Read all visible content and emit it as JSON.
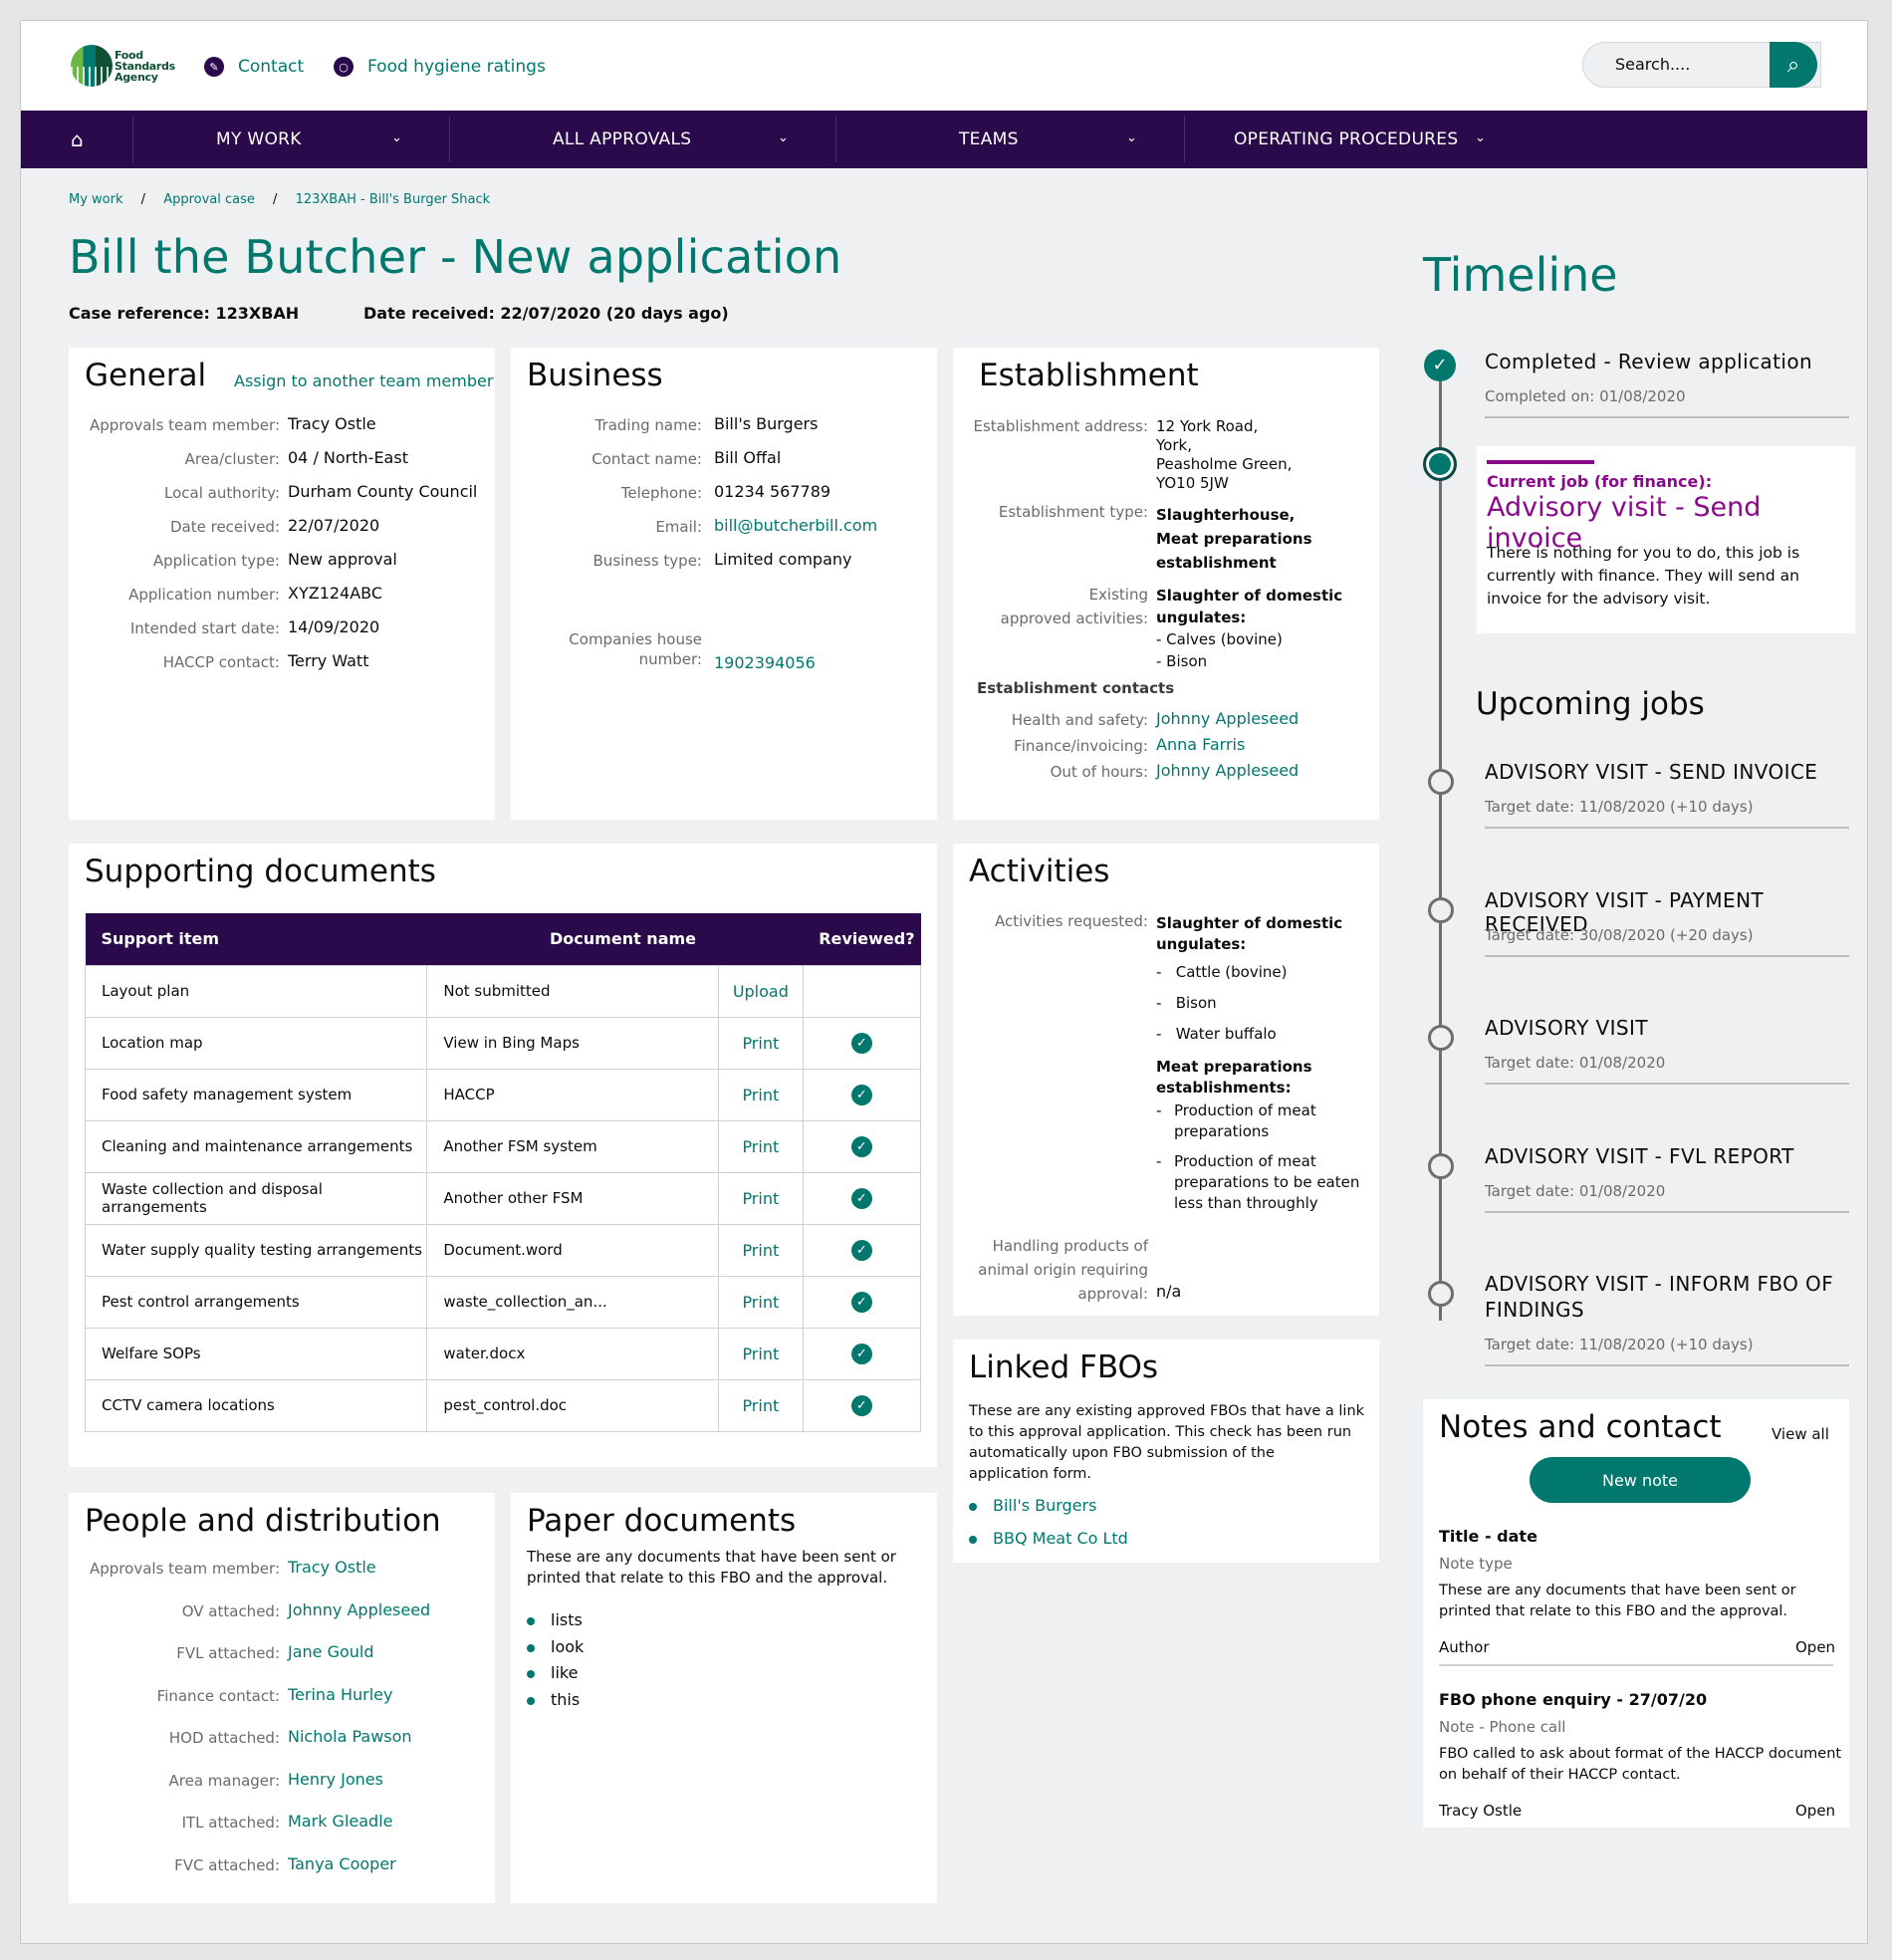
{
  "header": {
    "logo_text": "Food Standards Agency",
    "contact": "Contact",
    "ratings": "Food hygiene ratings",
    "search_placeholder": "Search...."
  },
  "nav": {
    "items": [
      "MY WORK",
      "ALL APPROVALS",
      "TEAMS",
      "OPERATING PROCEDURES"
    ]
  },
  "breadcrumbs": [
    "My work",
    "Approval case",
    "123XBAH - Bill's Burger Shack"
  ],
  "page": {
    "title": "Bill the Butcher - New application",
    "case_ref": "Case reference: 123XBAH",
    "date_received": "Date received: 22/07/2020 (20 days ago)"
  },
  "general": {
    "title": "General",
    "assign_link": "Assign to another team member",
    "rows": [
      [
        "Approvals team member:",
        "Tracy Ostle"
      ],
      [
        "Area/cluster:",
        "04 / North-East"
      ],
      [
        "Local authority:",
        "Durham County Council"
      ],
      [
        "Date received:",
        "22/07/2020"
      ],
      [
        "Application type:",
        "New approval"
      ],
      [
        "Application number:",
        "XYZ124ABC"
      ],
      [
        "Intended start date:",
        "14/09/2020"
      ],
      [
        "HACCP contact:",
        "Terry Watt"
      ]
    ]
  },
  "business": {
    "title": "Business",
    "rows": [
      [
        "Trading name:",
        "Bill's Burgers"
      ],
      [
        "Contact name:",
        "Bill Offal"
      ],
      [
        "Telephone:",
        "01234 567789"
      ],
      [
        "Email:",
        "bill@butcherbill.com"
      ],
      [
        "Business type:",
        "Limited company"
      ]
    ],
    "ch_label_1": "Companies house",
    "ch_label_2": "number:",
    "ch_value": "1902394056"
  },
  "establishment": {
    "title": "Establishment",
    "address_label": "Establishment address:",
    "address": [
      "12 York Road,",
      "York,",
      "Peasholme Green,",
      "YO10 5JW"
    ],
    "type_label": "Establishment type:",
    "type": [
      "Slaughterhouse,",
      "Meat preparations",
      "establishment"
    ],
    "existing_label_1": "Existing",
    "existing_label_2": "approved activities:",
    "existing": [
      "Slaughter of domestic",
      "ungulates:"
    ],
    "existing_items": [
      "- Calves (bovine)",
      "- Bison"
    ],
    "contacts_heading": "Establishment contacts",
    "contacts": [
      [
        "Health and safety:",
        "Johnny Appleseed"
      ],
      [
        "Finance/invoicing:",
        "Anna Farris"
      ],
      [
        "Out of hours:",
        "Johnny Appleseed"
      ]
    ]
  },
  "supporting": {
    "title": "Supporting documents",
    "headers": [
      "Support item",
      "Document name",
      "Reviewed?"
    ],
    "rows": [
      [
        "Layout plan",
        "Not submitted",
        "Upload",
        false
      ],
      [
        "Location map",
        "View in Bing Maps",
        "Print",
        true
      ],
      [
        "Food safety management system",
        "HACCP",
        "Print",
        true
      ],
      [
        "Cleaning and maintenance arrangements",
        "Another FSM system",
        "Print",
        true
      ],
      [
        "Waste collection and disposal arrangements",
        "Another other FSM",
        "Print",
        true
      ],
      [
        "Water supply quality testing arrangements",
        "Document.word",
        "Print",
        true
      ],
      [
        "Pest control arrangements",
        "waste_collection_an...",
        "Print",
        true
      ],
      [
        "Welfare SOPs",
        "water.docx",
        "Print",
        true
      ],
      [
        "CCTV camera locations",
        "pest_control.doc",
        "Print",
        true
      ]
    ]
  },
  "activities": {
    "title": "Activities",
    "req_label": "Activities requested:",
    "group1": [
      "Slaughter of domestic",
      "ungulates:"
    ],
    "group1_items": [
      "Cattle (bovine)",
      "Bison",
      "Water buffalo"
    ],
    "group2": [
      "Meat preparations",
      "establishments:"
    ],
    "group2_items": [
      [
        "Production of meat",
        "preparations"
      ],
      [
        "Production of meat",
        "preparations to be eaten",
        "less than throughly"
      ]
    ],
    "handling_label": [
      "Handling products of",
      "animal origin requiring",
      "approval:"
    ],
    "handling_value": "n/a"
  },
  "linked": {
    "title": "Linked FBOs",
    "text": [
      "These are any existing approved FBOs that have a link",
      "to this approval application. This check has been run",
      "automatically upon FBO submission of the",
      "application form."
    ],
    "links": [
      "Bill's Burgers",
      "BBQ Meat Co Ltd"
    ]
  },
  "people": {
    "title": "People and distribution",
    "rows": [
      [
        "Approvals team member:",
        "Tracy Ostle"
      ],
      [
        "OV attached:",
        "Johnny Appleseed"
      ],
      [
        "FVL attached:",
        "Jane Gould"
      ],
      [
        "Finance contact:",
        "Terina Hurley"
      ],
      [
        "HOD attached:",
        "Nichola Pawson"
      ],
      [
        "Area manager:",
        "Henry Jones"
      ],
      [
        "ITL attached:",
        "Mark Gleadle"
      ],
      [
        "FVC attached:",
        "Tanya Cooper"
      ]
    ]
  },
  "paper": {
    "title": "Paper documents",
    "text": [
      "These are any documents that have been sent or",
      "printed that relate to this FBO and the approval."
    ],
    "items": [
      "lists",
      "look",
      "like",
      "this"
    ]
  },
  "timeline": {
    "title": "Timeline",
    "completed": "Completed - Review application",
    "completed_on": "Completed on: 01/08/2020",
    "current_label": "Current job (for finance):",
    "current_title": "Advisory visit - Send invoice",
    "current_text": [
      "There is nothing for you to do, this job is",
      "currently with finance. They will send an",
      "invoice for the advisory visit."
    ],
    "upcoming": "Upcoming jobs",
    "jobs": [
      [
        "ADVISORY VISIT - SEND INVOICE",
        "Target date: 11/08/2020 (+10 days)"
      ],
      [
        "ADVISORY VISIT - PAYMENT RECEIVED",
        "Target date: 30/08/2020 (+20 days)"
      ],
      [
        "ADVISORY VISIT",
        "Target date: 01/08/2020"
      ],
      [
        "ADVISORY VISIT - FVL REPORT",
        "Target date: 01/08/2020"
      ],
      [
        "ADVISORY VISIT - INFORM FBO OF",
        "Target date: 11/08/2020 (+10 days)"
      ]
    ],
    "job5_line2": "FINDINGS"
  },
  "notes": {
    "title": "Notes and contact",
    "view_all": "View all",
    "new_note": "New note",
    "items": [
      {
        "title": "Title - date",
        "type": "Note type",
        "text": [
          "These are any documents that have been sent or",
          "printed that relate to this FBO and the approval."
        ],
        "author": "Author",
        "open": "Open"
      },
      {
        "title": "FBO phone enquiry - 27/07/20",
        "type": "Note - Phone call",
        "text": [
          "FBO called to ask about format of the HACCP document",
          "on behalf of their HACCP contact."
        ],
        "author": "Tracy Ostle",
        "open": "Open"
      }
    ]
  },
  "colors": {
    "teal": "#00786e",
    "purple": "#2a0a4a",
    "magenta": "#8b0a8b"
  }
}
